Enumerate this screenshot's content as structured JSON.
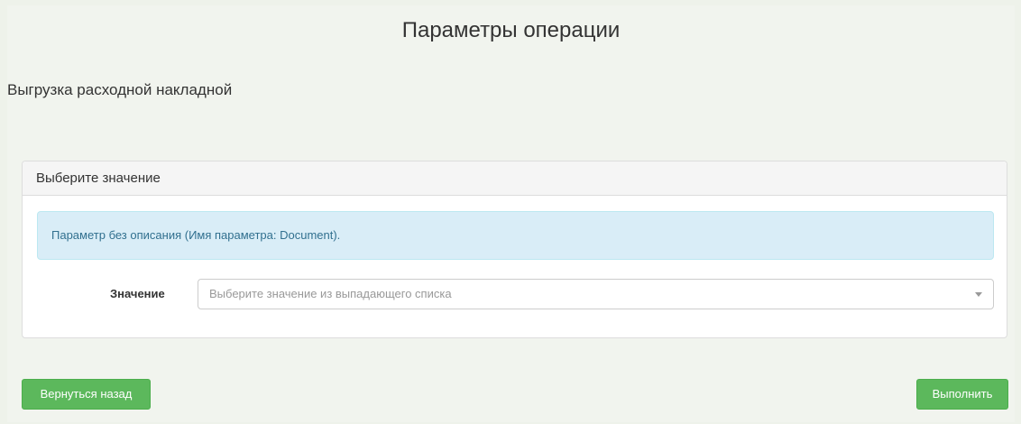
{
  "page": {
    "title": "Параметры операции",
    "operation_name": "Выгрузка расходной накладной"
  },
  "panel": {
    "heading": "Выберите значение",
    "info_text": "Параметр без описания (Имя параметра: Document).",
    "field_label": "Значение",
    "select": {
      "placeholder": "Выберите значение из выпадающего списка",
      "value": ""
    }
  },
  "buttons": {
    "back_label": "Вернуться назад",
    "run_label": "Выполнить"
  },
  "colors": {
    "button_green": "#5cb85c",
    "info_background": "#d9edf7",
    "info_text": "#31708f"
  },
  "icons": {
    "select_arrow": "caret-down-icon"
  }
}
